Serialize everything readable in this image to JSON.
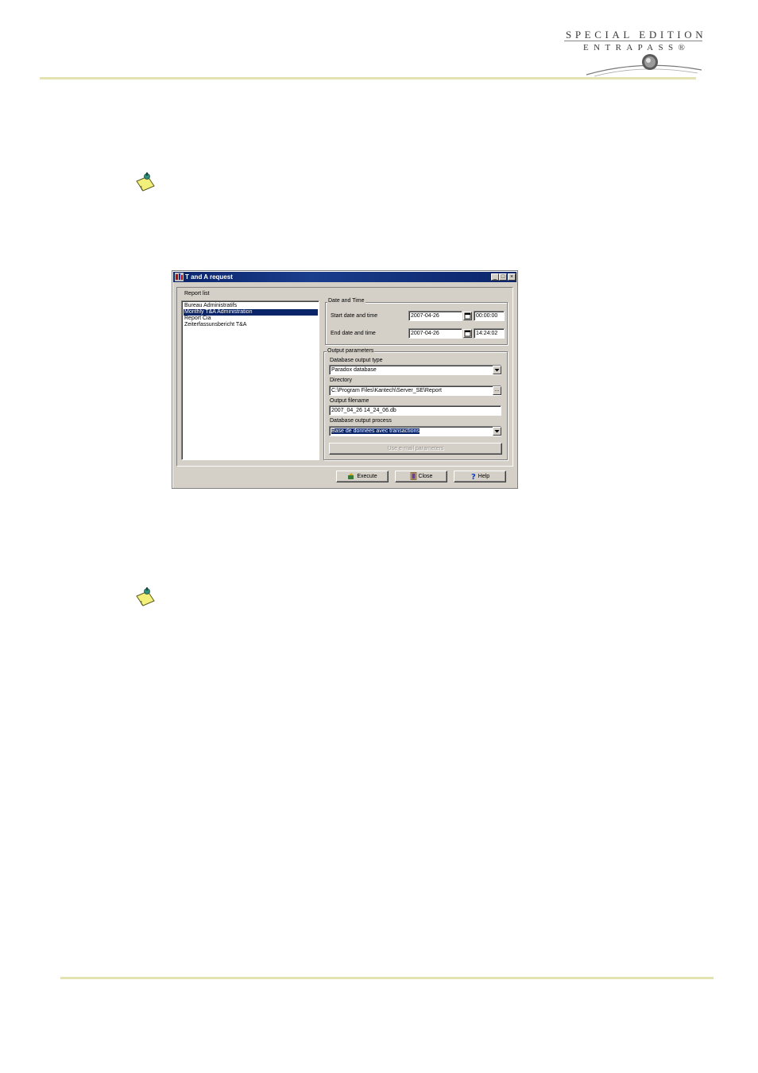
{
  "header": {
    "logo_line1": "SPECIAL EDITION",
    "logo_line2": "ENTRAPASS®"
  },
  "window": {
    "title": "T and A request",
    "controls": {
      "minimize": "_",
      "maximize": "□",
      "close": "×"
    },
    "report_list": {
      "label": "Report list",
      "items": [
        {
          "label": "Bureau Administratifs"
        },
        {
          "label": "Monthly T&A Administration"
        },
        {
          "label": "Report Cia"
        },
        {
          "label": "Zeiterfassunsbericht T&A"
        }
      ],
      "selected_index": 1
    },
    "date_time": {
      "group_title": "Date and Time",
      "start_label": "Start date and time",
      "start_date": "2007-04-26",
      "start_time": "00:00:00",
      "end_label": "End date and time",
      "end_date": "2007-04-26",
      "end_time": "14:24:02"
    },
    "output": {
      "group_title": "Output parameters",
      "db_type_label": "Database output type",
      "db_type_value": "Paradox database",
      "directory_label": "Directory",
      "directory_value": "C:\\Program Files\\Kantech\\Server_SE\\Report",
      "browse_label": "...",
      "filename_label": "Output filename",
      "filename_value": "2007_04_26 14_24_06.db",
      "process_label": "Database output process",
      "process_value": "Base de données avec transactions",
      "email_button": "Use e-mail parameters"
    },
    "buttons": {
      "execute": "Execute",
      "close": "Close",
      "help": "Help"
    }
  }
}
